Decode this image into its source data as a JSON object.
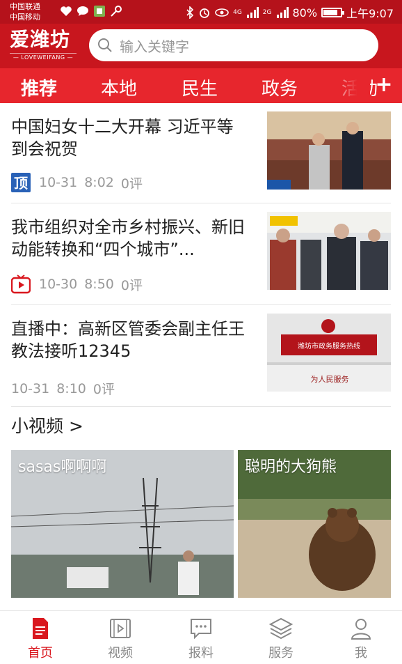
{
  "status_bar": {
    "carrier_1": "中国联通",
    "carrier_2": "中国移动",
    "network_1": "4G",
    "network_2": "2G",
    "battery": "80%",
    "time": "上午9:07"
  },
  "header": {
    "logo_text": "爱潍坊",
    "logo_sub": "— LOVEWEIFANG —",
    "search_placeholder": "输入关键字"
  },
  "tabs": {
    "items": [
      "推荐",
      "本地",
      "民生",
      "政务",
      "活动"
    ],
    "active": "推荐",
    "add": "+"
  },
  "news": [
    {
      "title": "中国妇女十二大开幕 习近平等到会祝贺",
      "source_icon": "ding-icon",
      "date": "10-31",
      "time": "8:02",
      "comments": "0评"
    },
    {
      "title": "我市组织对全市乡村振兴、新旧动能转换和“四个城市”...",
      "source_icon": "tv-icon",
      "date": "10-30",
      "time": "8:50",
      "comments": "0评"
    },
    {
      "title": "直播中：高新区管委会副主任王教法接听12345",
      "source_icon": "",
      "date": "10-31",
      "time": "8:10",
      "comments": "0评",
      "thumb_text_1": "潍坊市政务服务热线",
      "thumb_text_2": "为人民服务"
    }
  ],
  "short_video": {
    "heading": "小视频 >",
    "items": [
      {
        "title": "sasas啊啊啊"
      },
      {
        "title": "聪明的大狗熊"
      }
    ]
  },
  "bottom_nav": {
    "items": [
      "首页",
      "视频",
      "报料",
      "服务",
      "我"
    ],
    "active": "首页"
  },
  "colors": {
    "brand_red": "#c8161e",
    "tab_red": "#e7262d",
    "status_red": "#b5121b"
  }
}
